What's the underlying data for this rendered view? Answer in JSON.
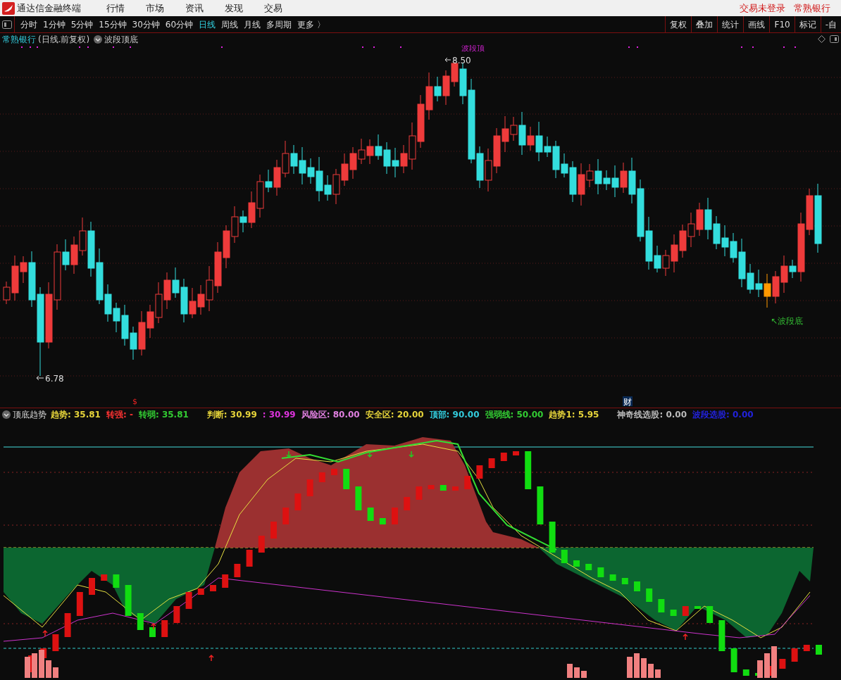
{
  "app": {
    "title": "通达信金融终端",
    "menus": [
      "行情",
      "市场",
      "资讯",
      "发现",
      "交易"
    ],
    "status_links": [
      "交易未登录",
      "常熟银行"
    ]
  },
  "periods": [
    {
      "label": "分时",
      "selected": false
    },
    {
      "label": "1分钟",
      "selected": false
    },
    {
      "label": "5分钟",
      "selected": false
    },
    {
      "label": "15分钟",
      "selected": false
    },
    {
      "label": "30分钟",
      "selected": false
    },
    {
      "label": "60分钟",
      "selected": false
    },
    {
      "label": "日线",
      "selected": true
    },
    {
      "label": "周线",
      "selected": false
    },
    {
      "label": "月线",
      "selected": false
    },
    {
      "label": "多周期",
      "selected": false
    },
    {
      "label": "更多 〉",
      "selected": false
    }
  ],
  "tools": [
    "复权",
    "叠加",
    "统计",
    "画线",
    "F10",
    "标记",
    "-自"
  ],
  "main_chart": {
    "stock": "常熟银行",
    "mode": "(日线.前复权)",
    "indicator": "波段顶底",
    "high_label": "8.50",
    "low_label": "6.78",
    "top_signal": "波段顶",
    "bottom_signal": "↖波段底",
    "events": [
      "$",
      "财"
    ]
  },
  "indicator": {
    "name": "顶底趋势",
    "legend": [
      {
        "text": "趋势: 35.81",
        "color": "#e6d43a"
      },
      {
        "text": "转强: -",
        "color": "#ff3333"
      },
      {
        "text": "转弱: 35.81",
        "color": "#33cc33"
      },
      {
        "text": "判断: 30.99",
        "color": "#e6d43a"
      },
      {
        "text": ": 30.99",
        "color": "#dd33dd"
      },
      {
        "text": "风险区: 80.00",
        "color": "#e080e0"
      },
      {
        "text": "安全区: 20.00",
        "color": "#e6d43a"
      },
      {
        "text": "顶部: 90.00",
        "color": "#33ccdd"
      },
      {
        "text": "强弱线: 50.00",
        "color": "#33cc33"
      },
      {
        "text": "趋势1: 5.95",
        "color": "#e6d43a"
      },
      {
        "text": "神奇线选股: 0.00",
        "color": "#bbbbbb"
      },
      {
        "text": "波段选股: 0.00",
        "color": "#2222dd"
      }
    ]
  }
}
